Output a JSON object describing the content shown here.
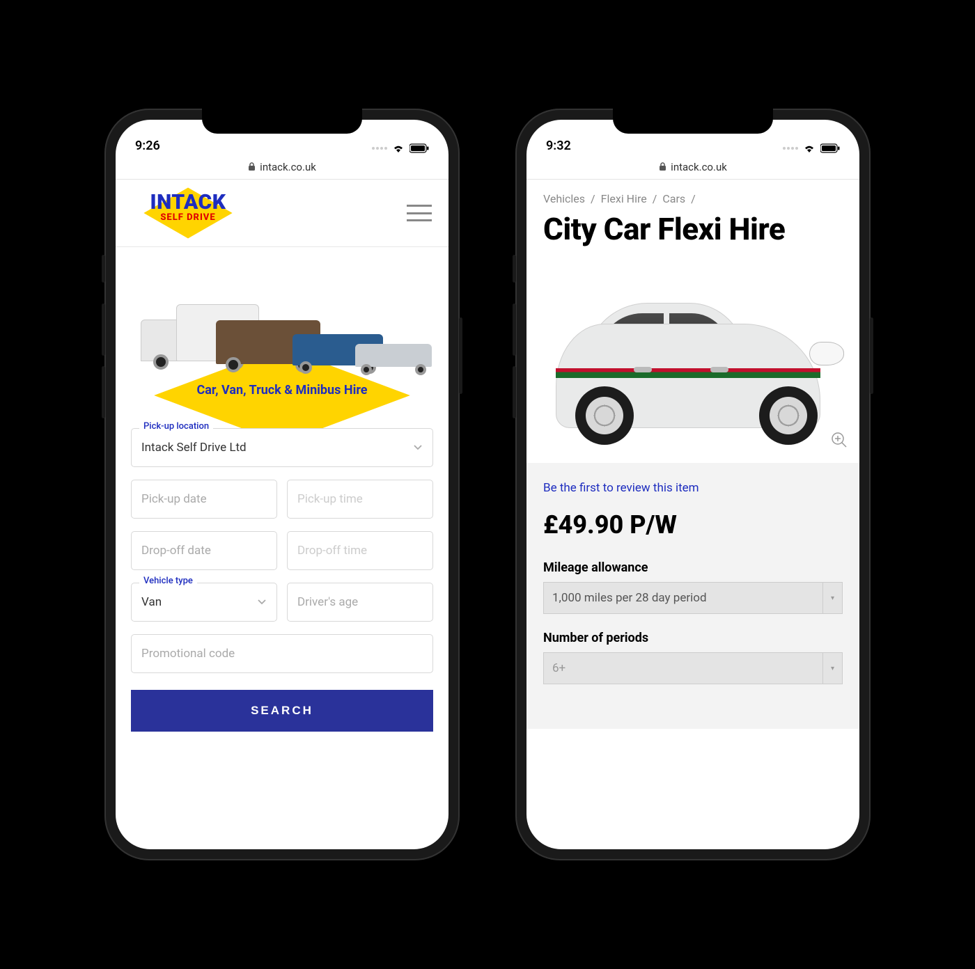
{
  "phone1": {
    "status": {
      "time": "9:26"
    },
    "url": "intack.co.uk",
    "logo": {
      "line1": "INTACK",
      "line2": "SELF DRIVE"
    },
    "hero_tagline": "Car, Van, Truck & Minibus Hire",
    "form": {
      "pickup_location_label": "Pick-up location",
      "pickup_location_value": "Intack Self Drive Ltd",
      "pickup_date_placeholder": "Pick-up date",
      "pickup_time_placeholder": "Pick-up time",
      "dropoff_date_placeholder": "Drop-off date",
      "dropoff_time_placeholder": "Drop-off time",
      "vehicle_type_label": "Vehicle type",
      "vehicle_type_value": "Van",
      "driver_age_placeholder": "Driver's age",
      "promo_placeholder": "Promotional code",
      "search_button": "SEARCH"
    }
  },
  "phone2": {
    "status": {
      "time": "9:32"
    },
    "url": "intack.co.uk",
    "breadcrumb": [
      "Vehicles",
      "Flexi Hire",
      "Cars"
    ],
    "title": "City Car Flexi Hire",
    "review_link": "Be the first to review this item",
    "price": "£49.90 P/W",
    "options": {
      "mileage_label": "Mileage allowance",
      "mileage_value": "1,000 miles per 28 day period",
      "periods_label": "Number of periods",
      "periods_value": "6+"
    }
  },
  "colors": {
    "brand_blue": "#1e2dbf",
    "brand_yellow": "#ffd400",
    "brand_red": "#e00000",
    "button_navy": "#2a329a"
  }
}
